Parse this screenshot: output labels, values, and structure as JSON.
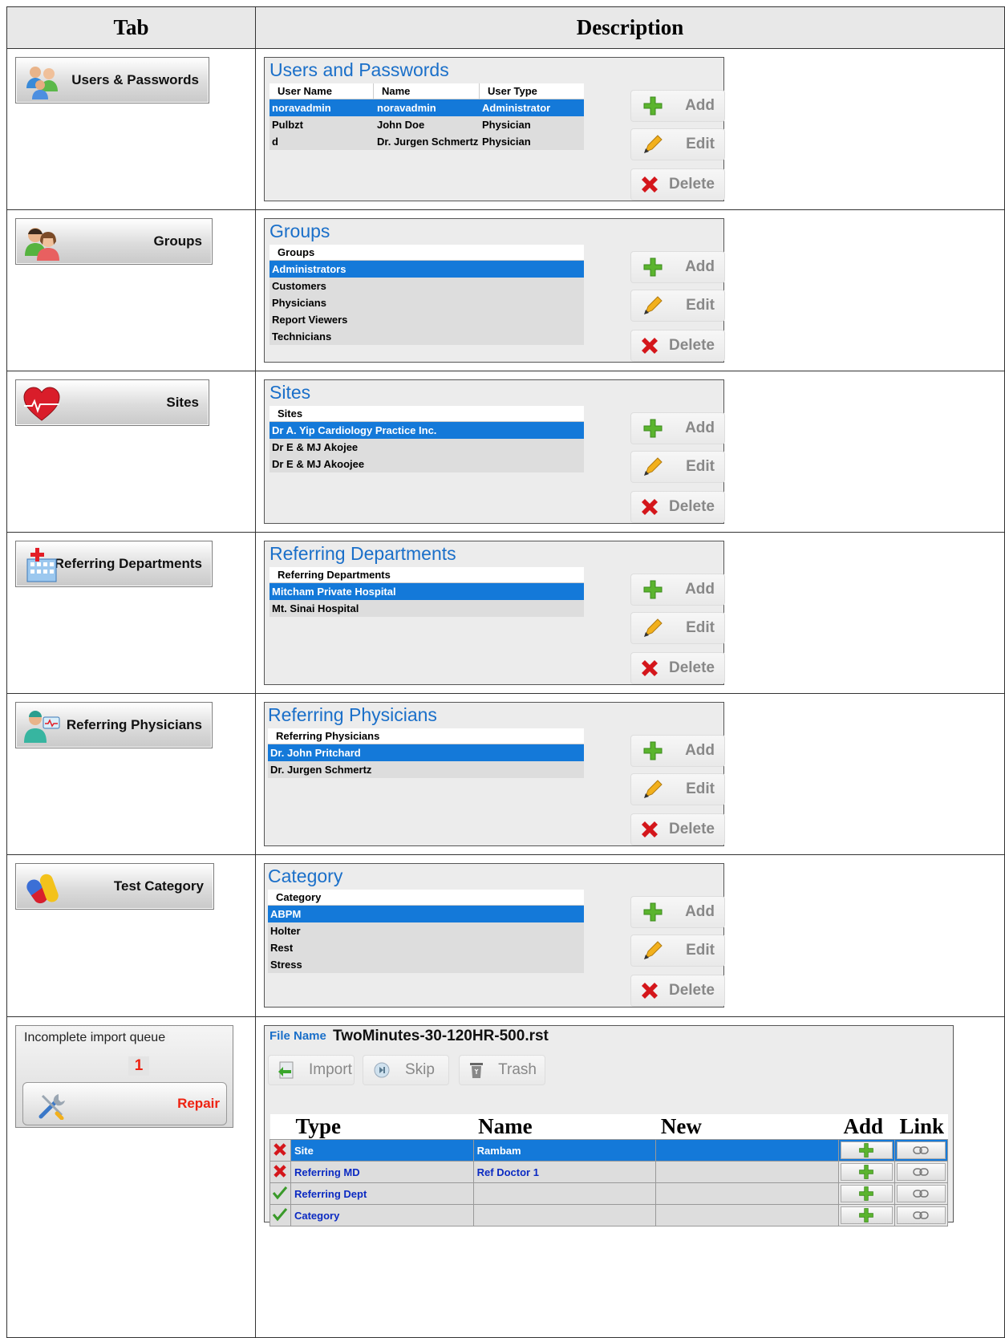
{
  "headers": {
    "tab": "Tab",
    "description": "Description"
  },
  "actions": {
    "add": "Add",
    "edit": "Edit",
    "delete": "Delete"
  },
  "rows": [
    {
      "tab_label": "Users & Passwords",
      "panel_title": "Users and Passwords",
      "columns": [
        "User Name",
        "Name",
        "User Type"
      ],
      "items": [
        [
          "noravadmin",
          "noravadmin",
          "Administrator"
        ],
        [
          "Pulbzt",
          "John Doe",
          "Physician"
        ],
        [
          "d",
          "Dr. Jurgen Schmertz",
          "Physician"
        ]
      ]
    },
    {
      "tab_label": "Groups",
      "panel_title": "Groups",
      "columns": [
        "Groups"
      ],
      "items": [
        [
          "Administrators"
        ],
        [
          "Customers"
        ],
        [
          "Physicians"
        ],
        [
          "Report Viewers"
        ],
        [
          "Technicians"
        ]
      ]
    },
    {
      "tab_label": "Sites",
      "panel_title": "Sites",
      "columns": [
        "Sites"
      ],
      "items": [
        [
          "Dr A. Yip Cardiology Practice Inc."
        ],
        [
          "Dr E & MJ Akojee"
        ],
        [
          "Dr E & MJ Akoojee"
        ]
      ]
    },
    {
      "tab_label": "Referring Departments",
      "panel_title": "Referring Departments",
      "columns": [
        "Referring Departments"
      ],
      "items": [
        [
          "Mitcham Private Hospital"
        ],
        [
          "Mt. Sinai Hospital"
        ]
      ]
    },
    {
      "tab_label": "Referring Physicians",
      "panel_title": "Referring Physicians",
      "columns": [
        "Referring Physicians"
      ],
      "items": [
        [
          "Dr. John Pritchard"
        ],
        [
          "Dr. Jurgen Schmertz"
        ]
      ]
    },
    {
      "tab_label": "Test Category",
      "panel_title": "Category",
      "columns": [
        "Category"
      ],
      "items": [
        [
          "ABPM"
        ],
        [
          "Holter"
        ],
        [
          "Rest"
        ],
        [
          "Stress"
        ]
      ]
    }
  ],
  "import": {
    "queue_label": "Incomplete  import queue",
    "queue_count": "1",
    "repair_label": "Repair",
    "file_name_label": "File Name",
    "file_name": "TwoMinutes-30-120HR-500.rst",
    "toolbar": {
      "import": "Import",
      "skip": "Skip",
      "trash": "Trash"
    },
    "columns": {
      "type": "Type",
      "name": "Name",
      "new": "New",
      "add": "Add",
      "link": "Link"
    },
    "entries": [
      {
        "status": "error",
        "type": "Site",
        "name": "Rambam",
        "new": ""
      },
      {
        "status": "error",
        "type": "Referring MD",
        "name": "Ref Doctor 1",
        "new": ""
      },
      {
        "status": "ok",
        "type": "Referring Dept",
        "name": "",
        "new": ""
      },
      {
        "status": "ok",
        "type": "Category",
        "name": "",
        "new": ""
      }
    ]
  },
  "colors": {
    "accent": "#1479d9",
    "title": "#1a6fc9",
    "error": "#e21111",
    "ok": "#3a9a2a"
  }
}
